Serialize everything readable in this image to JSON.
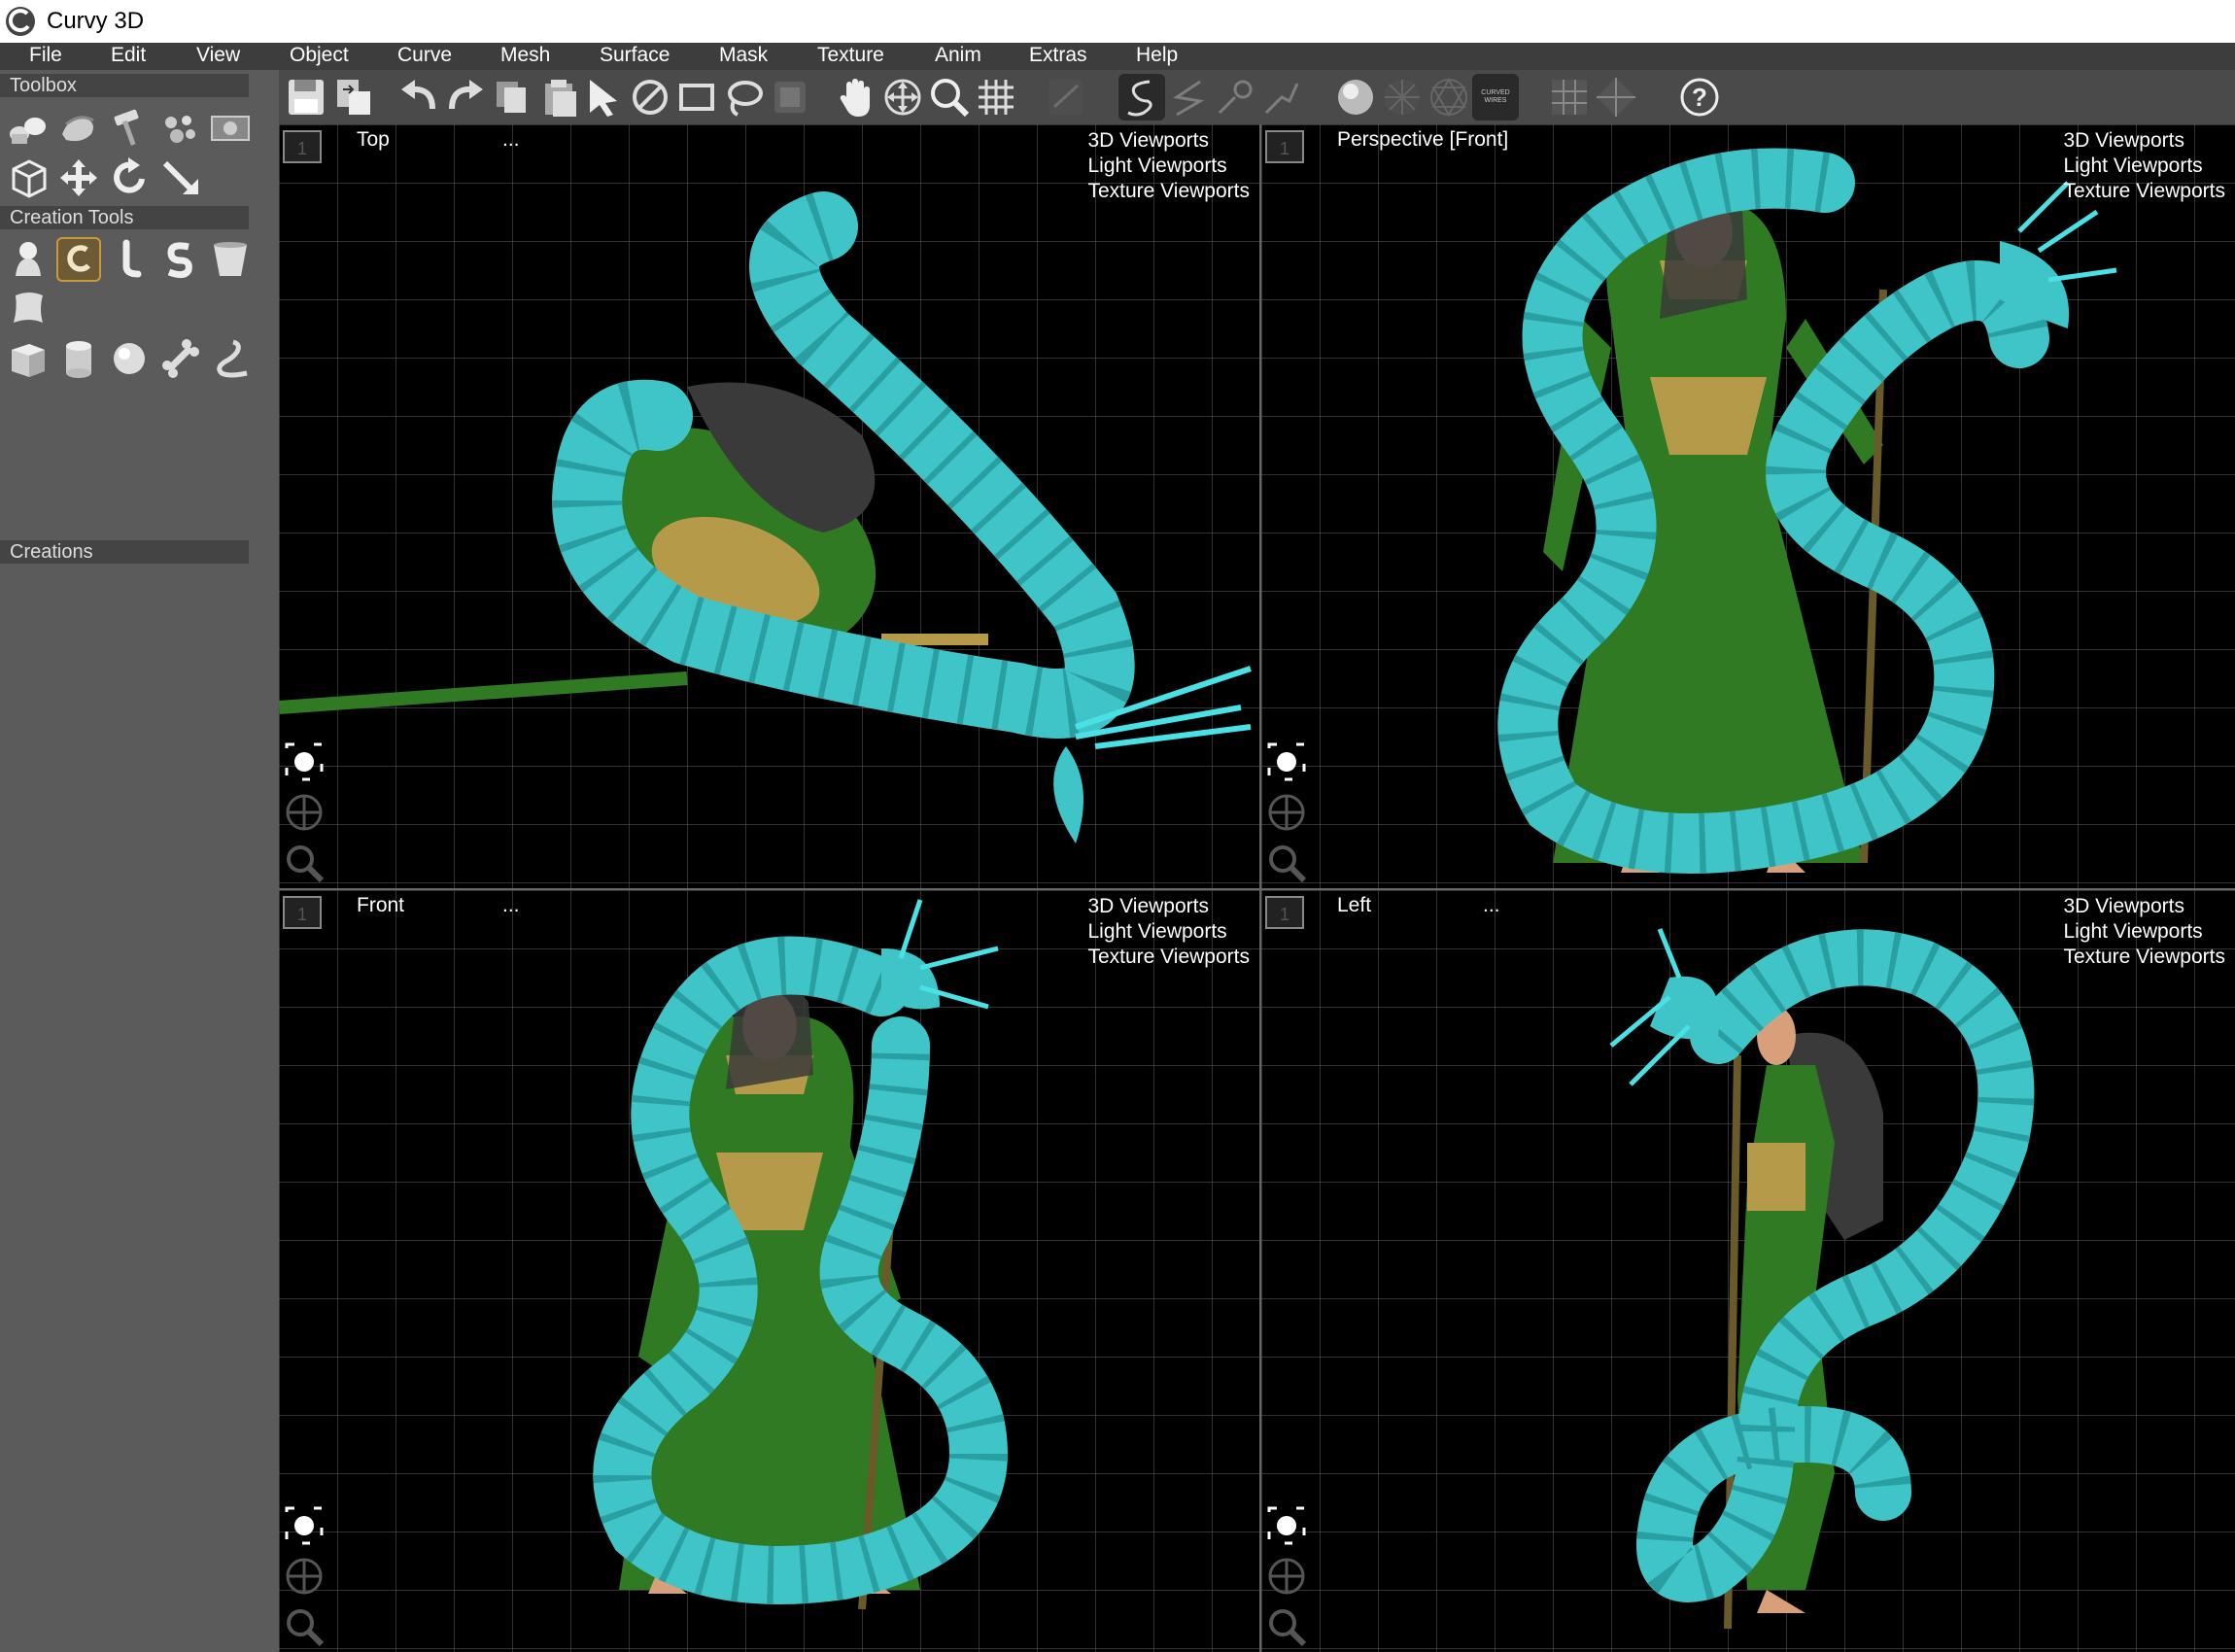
{
  "window": {
    "title": "Curvy 3D"
  },
  "menu": [
    "File",
    "Edit",
    "View",
    "Object",
    "Curve",
    "Mesh",
    "Surface",
    "Mask",
    "Texture",
    "Anim",
    "Extras",
    "Help"
  ],
  "left_panel": {
    "toolbox_header": "Toolbox",
    "creation_tools_header": "Creation Tools",
    "creations_header": "Creations",
    "toolbox_tools": [
      "create-objects-icon",
      "clay-icon",
      "hammer-icon",
      "particles-icon",
      "image-plane-icon",
      "cube-select-icon",
      "move-icon",
      "rotate-icon",
      "scale-icon"
    ],
    "creation_tools": [
      "blob-icon",
      "curve-tube-icon",
      "bent-tube-icon",
      "s-shape-icon",
      "lathe-icon",
      "surface-patch-icon",
      "box-primitive-icon",
      "cylinder-primitive-icon",
      "sphere-primitive-icon",
      "bone-icon",
      "hook-curve-icon"
    ]
  },
  "toolbar": {
    "buttons": [
      "save-icon",
      "export-icon",
      "undo-icon",
      "redo-icon",
      "copy-icon",
      "paste-icon",
      "select-arrow-icon",
      "no-select-icon",
      "rectangle-select-icon",
      "lasso-select-icon",
      "mask-select-icon",
      "pan-hand-icon",
      "move-view-icon",
      "zoom-icon",
      "grid-icon",
      "ruler-icon",
      "draw-curve-icon",
      "curve-tool-2-icon",
      "curve-tool-3-icon",
      "curve-tool-4-icon",
      "smooth-shading-icon",
      "wireframe-shading-icon",
      "wire-shading-icon",
      "curved-wires-icon",
      "show-grid-icon",
      "show-axis-icon",
      "help-icon"
    ],
    "curved_wires_label": "CURVED WIRES",
    "help_label": "?"
  },
  "viewports": [
    {
      "id": "1",
      "name": "Top",
      "dots": "...",
      "links": [
        "3D Viewports",
        "Light Viewports",
        "Texture Viewports"
      ],
      "link_dots": ".."
    },
    {
      "id": "1",
      "name": "Perspective [Front]",
      "dots": "",
      "links": [
        "3D Viewports",
        "Light Viewports",
        "Texture Viewports"
      ],
      "link_dots": ""
    },
    {
      "id": "1",
      "name": "Front",
      "dots": "...",
      "links": [
        "3D Viewports",
        "Light Viewports",
        "Texture Viewports"
      ],
      "link_dots": ".."
    },
    {
      "id": "1",
      "name": "Left",
      "dots": "...",
      "links": [
        "3D Viewports",
        "Light Viewports",
        "Texture Viewports"
      ],
      "link_dots": ""
    }
  ],
  "colors": {
    "dragon": "#3fc5c8",
    "robe": "#2f7a22",
    "gold": "#b59a4a",
    "skin": "#d8a07a",
    "hair": "#3a3a3a",
    "panel": "#5b5b5b",
    "menubar": "#3d3d3d"
  }
}
